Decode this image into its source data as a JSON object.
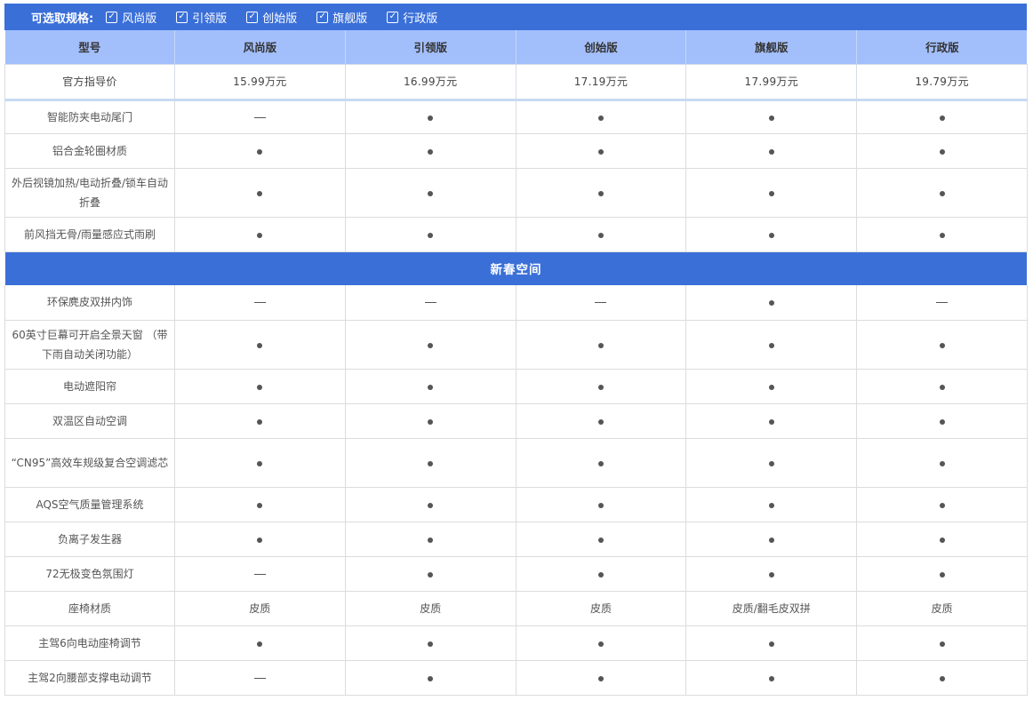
{
  "filter": {
    "label": "可选取规格:",
    "options": [
      "风尚版",
      "引领版",
      "创始版",
      "旗舰版",
      "行政版"
    ]
  },
  "header": {
    "model_label": "型号",
    "columns": [
      "风尚版",
      "引领版",
      "创始版",
      "旗舰版",
      "行政版"
    ]
  },
  "price": {
    "label": "官方指导价",
    "values": [
      "15.99万元",
      "16.99万元",
      "17.19万元",
      "17.99万元",
      "19.79万元"
    ]
  },
  "rows_top": [
    {
      "name": "智能防夹电动尾门",
      "values": [
        "-",
        "●",
        "●",
        "●",
        "●"
      ],
      "h": 38
    },
    {
      "name": "铝合金轮圈材质",
      "values": [
        "●",
        "●",
        "●",
        "●",
        "●"
      ],
      "h": 39
    },
    {
      "name": "外后视镜加热/电动折叠/锁车自动折叠",
      "values": [
        "●",
        "●",
        "●",
        "●",
        "●"
      ],
      "h": 55
    },
    {
      "name": "前风挡无骨/雨量感应式雨刷",
      "values": [
        "●",
        "●",
        "●",
        "●",
        "●"
      ],
      "h": 39
    }
  ],
  "section": {
    "title": "新春空间"
  },
  "rows_bottom": [
    {
      "name": "环保麂皮双拼内饰",
      "values": [
        "-",
        "-",
        "-",
        "●",
        "-"
      ],
      "h": 39
    },
    {
      "name": "60英寸巨幕可开启全景天窗 （带下雨自动关闭功能）",
      "values": [
        "●",
        "●",
        "●",
        "●",
        "●"
      ],
      "h": 55
    },
    {
      "name": "电动遮阳帘",
      "values": [
        "●",
        "●",
        "●",
        "●",
        "●"
      ],
      "h": 39
    },
    {
      "name": "双温区自动空调",
      "values": [
        "●",
        "●",
        "●",
        "●",
        "●"
      ],
      "h": 39
    },
    {
      "name": "“CN95”高效车规级复合空调滤芯",
      "values": [
        "●",
        "●",
        "●",
        "●",
        "●"
      ],
      "h": 55
    },
    {
      "name": "AQS空气质量管理系统",
      "values": [
        "●",
        "●",
        "●",
        "●",
        "●"
      ],
      "h": 39
    },
    {
      "name": "负离子发生器",
      "values": [
        "●",
        "●",
        "●",
        "●",
        "●"
      ],
      "h": 39
    },
    {
      "name": "72无极变色氛围灯",
      "values": [
        "-",
        "●",
        "●",
        "●",
        "●"
      ],
      "h": 39
    },
    {
      "name": "座椅材质",
      "values": [
        "皮质",
        "皮质",
        "皮质",
        "皮质/翻毛皮双拼",
        "皮质"
      ],
      "h": 39
    },
    {
      "name": "主驾6向电动座椅调节",
      "values": [
        "●",
        "●",
        "●",
        "●",
        "●"
      ],
      "h": 39
    },
    {
      "name": "主驾2向腰部支撑电动调节",
      "values": [
        "-",
        "●",
        "●",
        "●",
        "●"
      ],
      "h": 39
    }
  ]
}
